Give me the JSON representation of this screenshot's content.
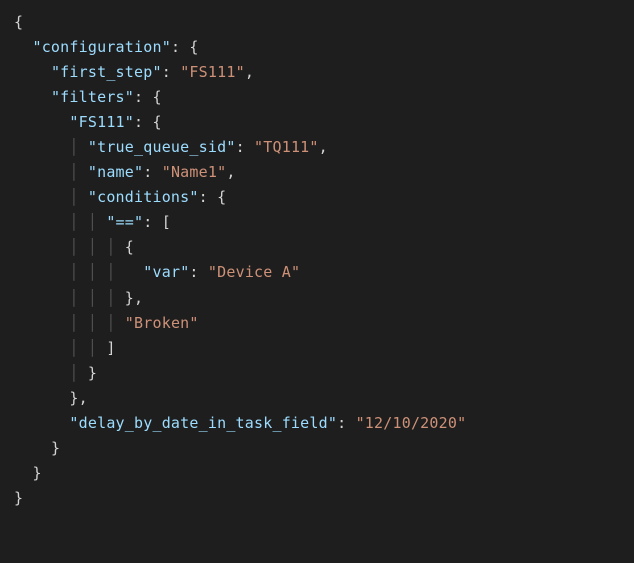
{
  "code": {
    "keys": {
      "configuration": "\"configuration\"",
      "first_step": "\"first_step\"",
      "filters": "\"filters\"",
      "fs111": "\"FS111\"",
      "true_queue_sid": "\"true_queue_sid\"",
      "name": "\"name\"",
      "conditions": "\"conditions\"",
      "eq": "\"==\"",
      "var": "\"var\"",
      "delay": "\"delay_by_date_in_task_field\""
    },
    "vals": {
      "first_step": "\"FS111\"",
      "true_queue_sid": "\"TQ111\"",
      "name": "\"Name1\"",
      "var": "\"Device A\"",
      "broken": "\"Broken\"",
      "delay": "\"12/10/2020\""
    },
    "punct": {
      "open_brace": "{",
      "close_brace": "}",
      "open_bracket": "[",
      "close_bracket": "]",
      "colon_open": ": {",
      "colon_open_arr": ": [",
      "colon_sp": ": ",
      "comma": ",",
      "close_brace_comma": "},"
    }
  }
}
